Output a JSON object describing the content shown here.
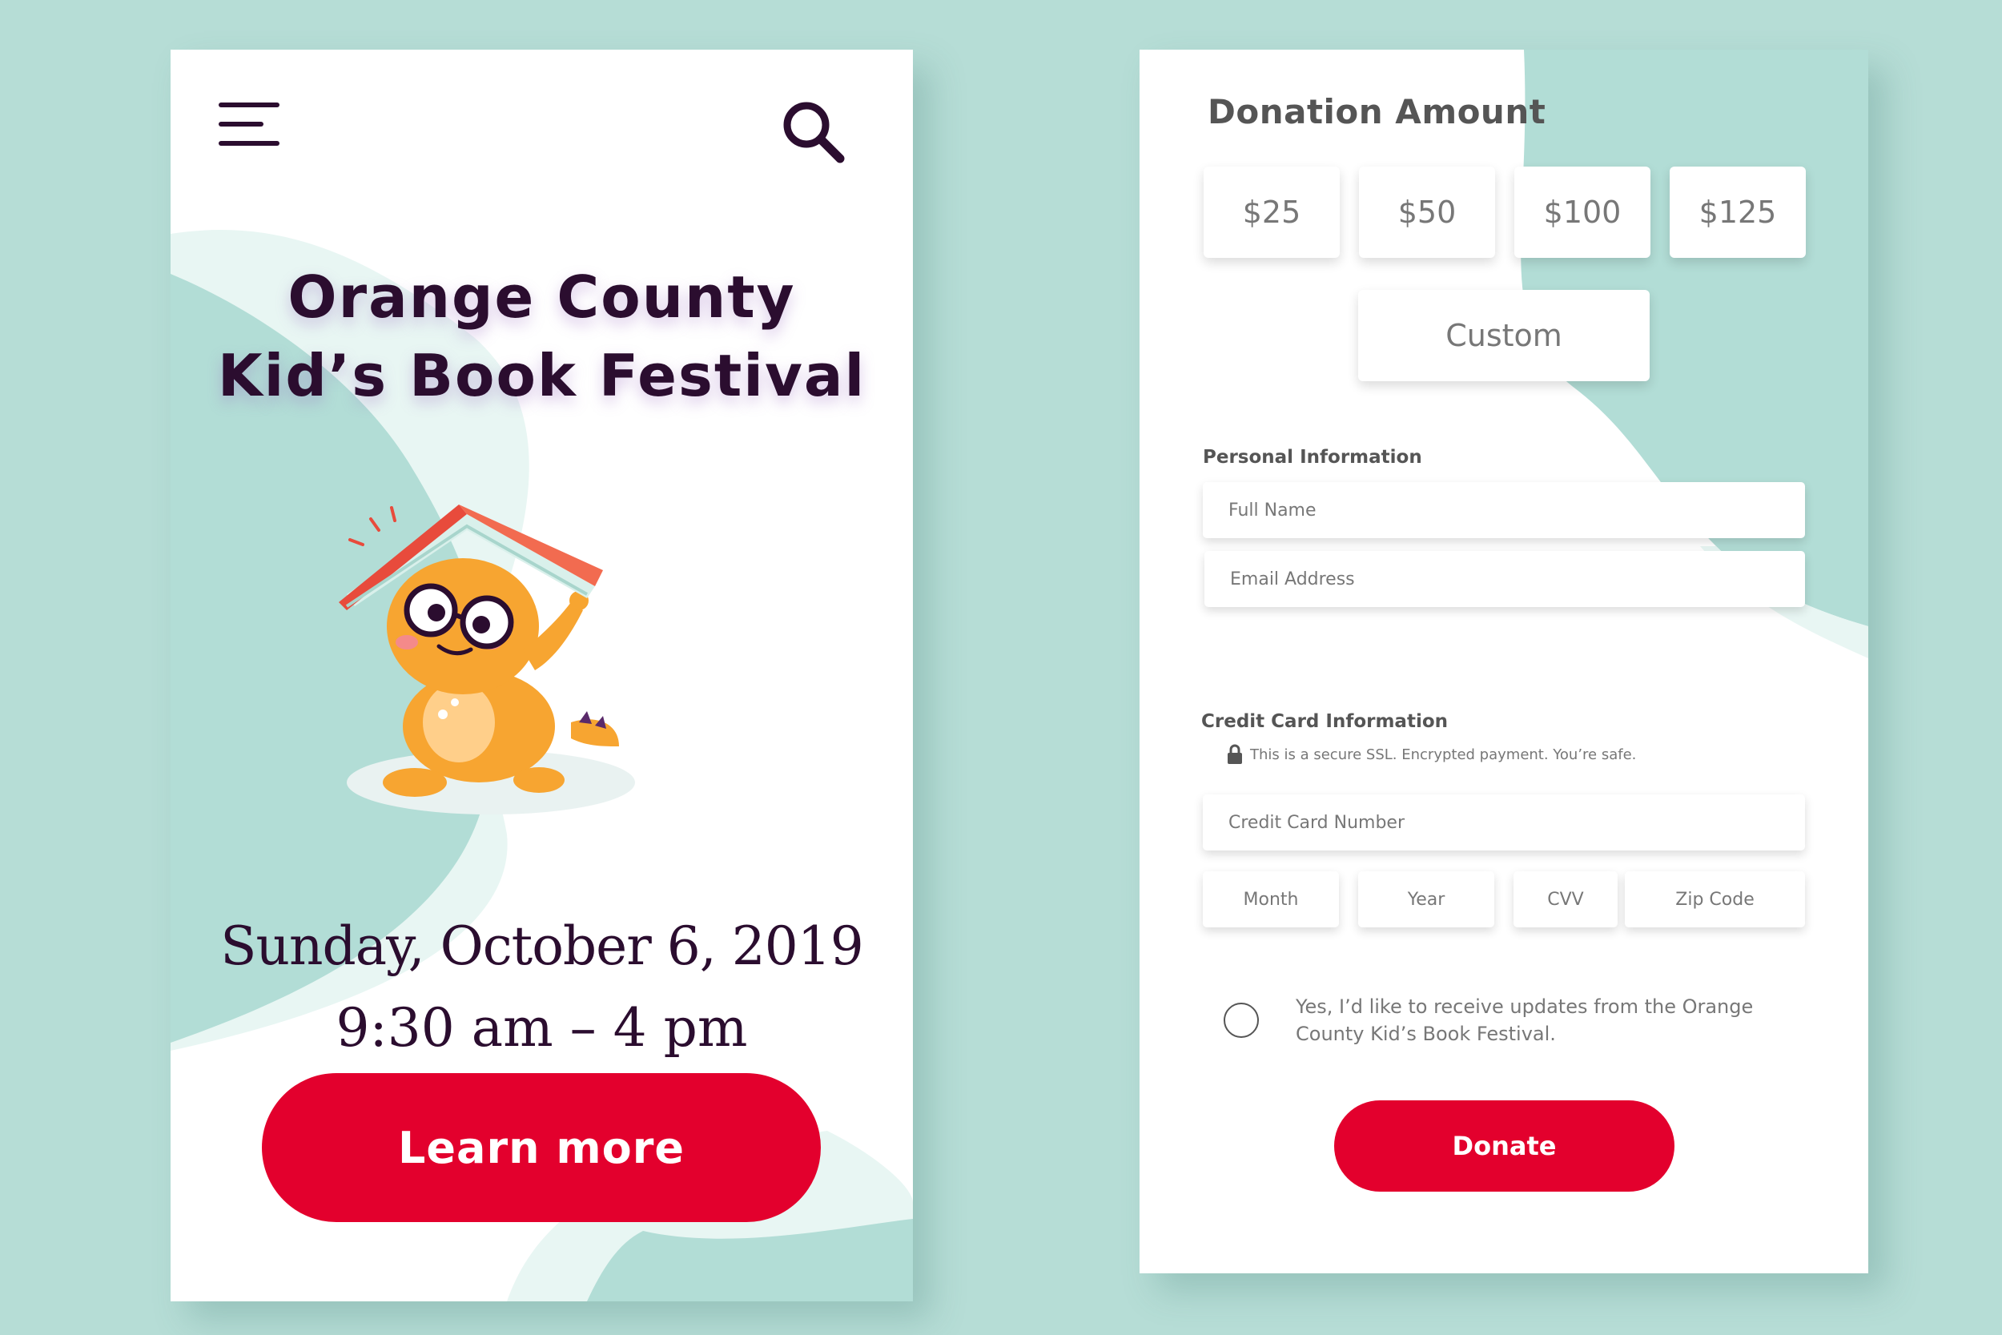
{
  "colors": {
    "page_background": "#b6ddd6",
    "primary": "#e3002d",
    "title_text": "#2b0d2f",
    "decor_teal": "#b2ddd6",
    "decor_light": "#e8f6f3"
  },
  "event_screen": {
    "menu_icon": "hamburger-menu-icon",
    "search_icon": "search-icon",
    "title_line1": "Orange County",
    "title_line2": "Kid’s Book Festival",
    "illustration": "dinosaur-reading-book",
    "date": "Sunday, October 6, 2019",
    "time": "9:30 am – 4 pm",
    "cta_label": "Learn more"
  },
  "donation_screen": {
    "title": "Donation Amount",
    "amounts": [
      "$25",
      "$50",
      "$100",
      "$125"
    ],
    "custom_label": "Custom",
    "personal_info": {
      "label": "Personal Information",
      "full_name_placeholder": "Full Name",
      "email_placeholder": "Email Address"
    },
    "credit_card": {
      "label": "Credit Card Information",
      "secure_icon": "lock-icon",
      "secure_note": "This is a secure SSL. Encrypted payment. You’re safe.",
      "number_placeholder": "Credit Card Number",
      "month_placeholder": "Month",
      "year_placeholder": "Year",
      "cvv_placeholder": "CVV",
      "zip_placeholder": "Zip Code"
    },
    "consent_text": "Yes, I’d like to receive updates from the Orange County Kid’s Book Festival.",
    "donate_label": "Donate"
  }
}
